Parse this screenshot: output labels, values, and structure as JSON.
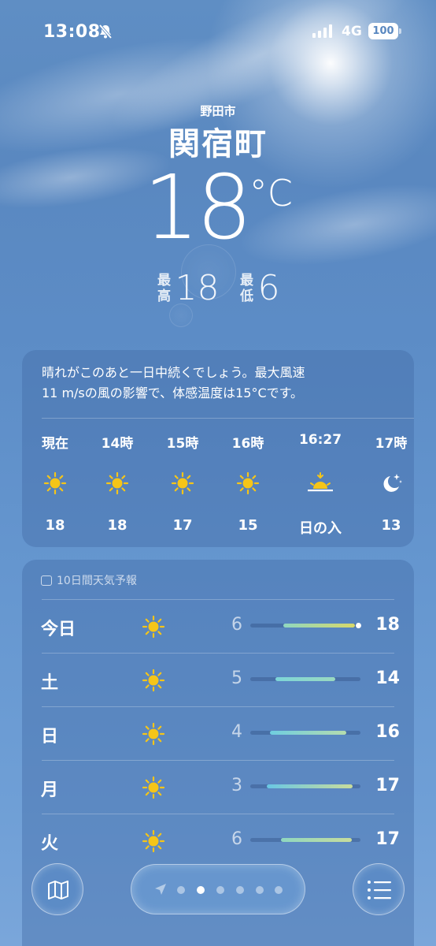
{
  "status_bar": {
    "time": "13:08",
    "network": "4G",
    "battery": "100",
    "icons": [
      "bell-slash-icon",
      "signal-bars-icon"
    ]
  },
  "location": {
    "area": "野田市",
    "name": "関宿町"
  },
  "current": {
    "temp": "18",
    "unit": "°C",
    "high_label": "最高",
    "high": "18",
    "low_label": "最低",
    "low": "6"
  },
  "hourly": {
    "summary_line1": "晴れがこのあと一日中続くでしょう。最大風速",
    "summary_line2": "11 m/sの風の影響で、体感温度は15°Cです。",
    "items": [
      {
        "label": "現在",
        "icon": "sun-icon",
        "value": "18"
      },
      {
        "label": "14時",
        "icon": "sun-icon",
        "value": "18"
      },
      {
        "label": "15時",
        "icon": "sun-icon",
        "value": "17"
      },
      {
        "label": "16時",
        "icon": "sun-icon",
        "value": "15"
      },
      {
        "label": "16:27",
        "icon": "sunset-icon",
        "value": "日の入"
      },
      {
        "label": "17時",
        "icon": "moon-stars-icon",
        "value": "13"
      }
    ]
  },
  "daily": {
    "title": "10日間天気予報",
    "days": [
      {
        "name": "今日",
        "icon": "sun-icon",
        "low": "6",
        "high": "18",
        "bar_start": 0.3,
        "bar_end": 0.95,
        "current_marker": 0.98,
        "gradient": [
          "#8fd7c0",
          "#d8d86a"
        ]
      },
      {
        "name": "土",
        "icon": "sun-icon",
        "low": "5",
        "high": "14",
        "bar_start": 0.23,
        "bar_end": 0.77,
        "gradient": [
          "#7dd5d8",
          "#9ad9c0"
        ]
      },
      {
        "name": "日",
        "icon": "sun-icon",
        "low": "4",
        "high": "16",
        "bar_start": 0.18,
        "bar_end": 0.87,
        "gradient": [
          "#6fcde0",
          "#b5dcae"
        ]
      },
      {
        "name": "月",
        "icon": "sun-icon",
        "low": "3",
        "high": "17",
        "bar_start": 0.15,
        "bar_end": 0.93,
        "gradient": [
          "#69c7e4",
          "#c8dc9c"
        ]
      },
      {
        "name": "火",
        "icon": "sun-icon",
        "low": "6",
        "high": "17",
        "bar_start": 0.28,
        "bar_end": 0.92,
        "gradient": [
          "#8fd7c0",
          "#c8dc9c"
        ]
      }
    ]
  },
  "bottom_bar": {
    "page_count": 6,
    "active_page": 1,
    "icons": [
      "map-icon",
      "location-arrow-icon",
      "list-icon"
    ]
  },
  "colors": {
    "sun": "#f5c518",
    "sky": "#5c8cc6"
  }
}
